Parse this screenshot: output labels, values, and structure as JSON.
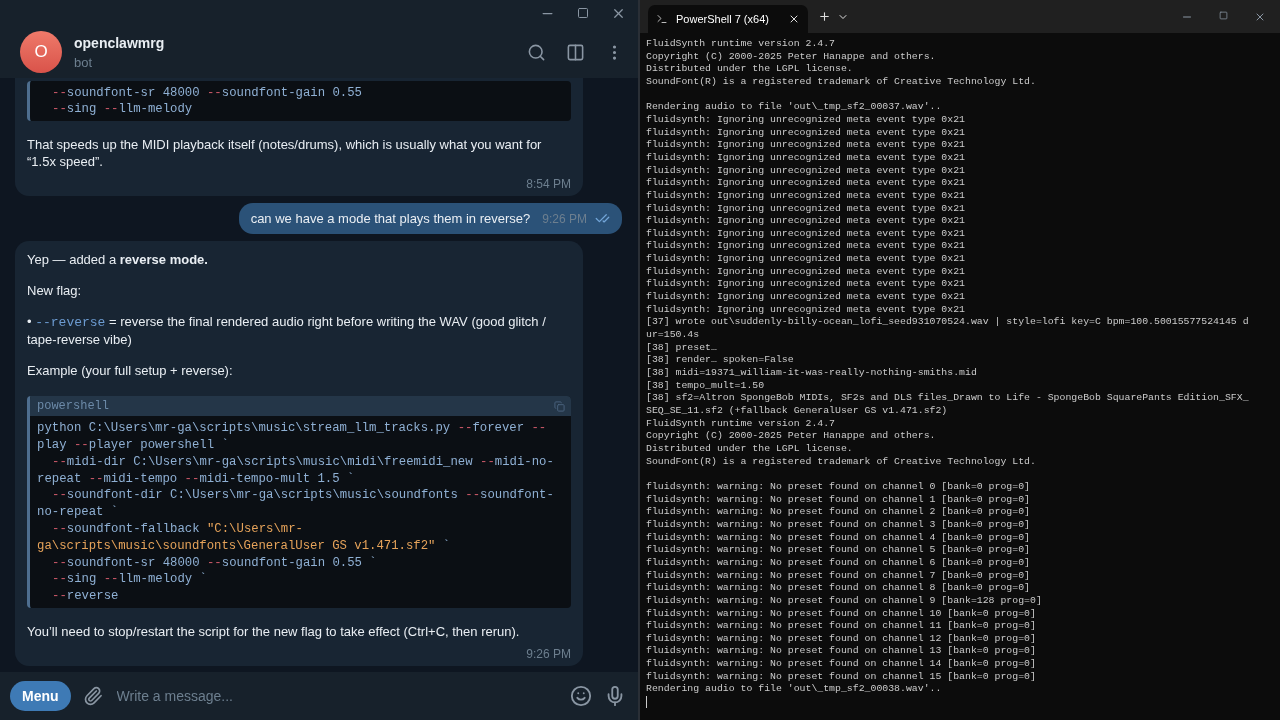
{
  "chat": {
    "header": {
      "avatar_letter": "O",
      "name": "openclawmrg",
      "status": "bot"
    },
    "messages": [
      {
        "kind": "incoming",
        "blocks": [
          {
            "kind": "code",
            "lines": [
              {
                "indent": true,
                "tokens": [
                  {
                    "kind": "op",
                    "t": "--"
                  },
                  {
                    "kind": "plain",
                    "t": "soundfont-sr 48000 "
                  },
                  {
                    "kind": "op",
                    "t": "--"
                  },
                  {
                    "kind": "plain",
                    "t": "soundfont-gain 0.55"
                  }
                ]
              },
              {
                "indent": true,
                "tokens": [
                  {
                    "kind": "op",
                    "t": "--"
                  },
                  {
                    "kind": "plain",
                    "t": "sing "
                  },
                  {
                    "kind": "op",
                    "t": "--"
                  },
                  {
                    "kind": "plain",
                    "t": "llm-melody"
                  }
                ]
              }
            ]
          },
          {
            "kind": "text",
            "segments": [
              {
                "kind": "text",
                "t": "That speeds up the MIDI playback itself (notes/drums), which is usually what you want for “1.5x speed”."
              }
            ]
          }
        ],
        "time": "8:54 PM"
      },
      {
        "kind": "outgoing",
        "blocks": [
          {
            "kind": "text",
            "segments": [
              {
                "kind": "text",
                "t": "can we have a mode that plays them in reverse?"
              }
            ]
          }
        ],
        "time": "9:26 PM",
        "read": true
      },
      {
        "kind": "incoming",
        "blocks": [
          {
            "kind": "text",
            "segments": [
              {
                "kind": "text",
                "t": "Yep — added a **reverse mode.**"
              }
            ]
          },
          {
            "kind": "text",
            "segments": [
              {
                "kind": "text",
                "t": "New flag:"
              }
            ]
          },
          {
            "kind": "text",
            "segments": [
              {
                "kind": "text",
                "t": "• "
              },
              {
                "kind": "code",
                "t": "--reverse"
              },
              {
                "kind": "text",
                "t": " = reverse the final rendered audio right before writing the WAV (good glitch / tape-reverse vibe)"
              }
            ]
          },
          {
            "kind": "text",
            "segments": [
              {
                "kind": "text",
                "t": "Example (your full setup + reverse):"
              }
            ]
          },
          {
            "kind": "code",
            "language": "powershell",
            "lines": [
              {
                "indent": false,
                "tokens": [
                  {
                    "kind": "plain",
                    "t": "python C:\\Users\\mr-ga\\scripts\\music\\stream_llm_tracks.py "
                  },
                  {
                    "kind": "op",
                    "t": "--"
                  },
                  {
                    "kind": "plain",
                    "t": "forever "
                  },
                  {
                    "kind": "op",
                    "t": "--"
                  }
                ]
              },
              {
                "indent": false,
                "tokens": [
                  {
                    "kind": "plain",
                    "t": "play "
                  },
                  {
                    "kind": "op",
                    "t": "--"
                  },
                  {
                    "kind": "plain",
                    "t": "player powershell `"
                  }
                ]
              },
              {
                "indent": true,
                "tokens": [
                  {
                    "kind": "op",
                    "t": "--"
                  },
                  {
                    "kind": "plain",
                    "t": "midi-dir C:\\Users\\mr-ga\\scripts\\music\\midi\\freemidi_new "
                  },
                  {
                    "kind": "op",
                    "t": "--"
                  },
                  {
                    "kind": "plain",
                    "t": "midi-no-"
                  }
                ]
              },
              {
                "indent": false,
                "tokens": [
                  {
                    "kind": "plain",
                    "t": "repeat "
                  },
                  {
                    "kind": "op",
                    "t": "--"
                  },
                  {
                    "kind": "plain",
                    "t": "midi-tempo "
                  },
                  {
                    "kind": "op",
                    "t": "--"
                  },
                  {
                    "kind": "plain",
                    "t": "midi-tempo-mult 1.5 `"
                  }
                ]
              },
              {
                "indent": true,
                "tokens": [
                  {
                    "kind": "op",
                    "t": "--"
                  },
                  {
                    "kind": "plain",
                    "t": "soundfont-dir C:\\Users\\mr-ga\\scripts\\music\\soundfonts "
                  },
                  {
                    "kind": "op",
                    "t": "--"
                  },
                  {
                    "kind": "plain",
                    "t": "soundfont-"
                  }
                ]
              },
              {
                "indent": false,
                "tokens": [
                  {
                    "kind": "plain",
                    "t": "no-repeat `"
                  }
                ]
              },
              {
                "indent": true,
                "tokens": [
                  {
                    "kind": "op",
                    "t": "--"
                  },
                  {
                    "kind": "plain",
                    "t": "soundfont-fallback "
                  },
                  {
                    "kind": "str",
                    "t": "\"C:\\Users\\mr-"
                  }
                ]
              },
              {
                "indent": false,
                "tokens": [
                  {
                    "kind": "str",
                    "t": "ga\\scripts\\music\\soundfonts\\GeneralUser GS v1.471.sf2\""
                  },
                  {
                    "kind": "plain",
                    "t": " `"
                  }
                ]
              },
              {
                "indent": true,
                "tokens": [
                  {
                    "kind": "op",
                    "t": "--"
                  },
                  {
                    "kind": "plain",
                    "t": "soundfont-sr 48000 "
                  },
                  {
                    "kind": "op",
                    "t": "--"
                  },
                  {
                    "kind": "plain",
                    "t": "soundfont-gain 0.55 `"
                  }
                ]
              },
              {
                "indent": true,
                "tokens": [
                  {
                    "kind": "op",
                    "t": "--"
                  },
                  {
                    "kind": "plain",
                    "t": "sing "
                  },
                  {
                    "kind": "op",
                    "t": "--"
                  },
                  {
                    "kind": "plain",
                    "t": "llm-melody `"
                  }
                ]
              },
              {
                "indent": true,
                "tokens": [
                  {
                    "kind": "op",
                    "t": "--"
                  },
                  {
                    "kind": "plain",
                    "t": "reverse"
                  }
                ]
              }
            ]
          },
          {
            "kind": "text",
            "segments": [
              {
                "kind": "text",
                "t": "You’ll need to stop/restart the script for the new flag to take effect (Ctrl+C, then rerun)."
              }
            ]
          }
        ],
        "time": "9:26 PM"
      }
    ],
    "composer": {
      "menu_button": "Menu",
      "placeholder": "Write a message..."
    }
  },
  "terminal": {
    "tab": {
      "title": "PowerShell 7 (x64)",
      "selected": true
    },
    "output": [
      [
        "FluidSynth runtime version 2.4.7",
        "Copyright (C) 2000-2025 Peter Hanappe and others.",
        "Distributed under the LGPL license.",
        "SoundFont(R) is a registered trademark of Creative Technology Ltd."
      ],
      [
        "Rendering audio to file 'out\\_tmp_sf2_00037.wav'..",
        "fluidsynth: Ignoring unrecognized meta event type 0x21",
        "fluidsynth: Ignoring unrecognized meta event type 0x21",
        "fluidsynth: Ignoring unrecognized meta event type 0x21",
        "fluidsynth: Ignoring unrecognized meta event type 0x21",
        "fluidsynth: Ignoring unrecognized meta event type 0x21",
        "fluidsynth: Ignoring unrecognized meta event type 0x21",
        "fluidsynth: Ignoring unrecognized meta event type 0x21",
        "fluidsynth: Ignoring unrecognized meta event type 0x21",
        "fluidsynth: Ignoring unrecognized meta event type 0x21",
        "fluidsynth: Ignoring unrecognized meta event type 0x21",
        "fluidsynth: Ignoring unrecognized meta event type 0x21",
        "fluidsynth: Ignoring unrecognized meta event type 0x21",
        "fluidsynth: Ignoring unrecognized meta event type 0x21",
        "fluidsynth: Ignoring unrecognized meta event type 0x21",
        "fluidsynth: Ignoring unrecognized meta event type 0x21",
        "fluidsynth: Ignoring unrecognized meta event type 0x21",
        "[37] wrote out\\suddenly-billy-ocean_lofi_seed931070524.wav | style=lofi key=C bpm=100.50015577524145 d",
        "ur=150.4s",
        "[38] preset…",
        "[38] render… spoken=False",
        "[38] midi=19371_william-it-was-really-nothing-smiths.mid",
        "[38] tempo_mult=1.50",
        "[38] sf2=Altron SpongeBob MIDIs, SF2s and DLS files_Drawn to Life - SpongeBob SquarePants Edition_SFX_",
        "SEQ_SE_11.sf2 (+fallback GeneralUser GS v1.471.sf2)",
        "FluidSynth runtime version 2.4.7",
        "Copyright (C) 2000-2025 Peter Hanappe and others.",
        "Distributed under the LGPL license.",
        "SoundFont(R) is a registered trademark of Creative Technology Ltd."
      ],
      [
        "fluidsynth: warning: No preset found on channel 0 [bank=0 prog=0]",
        "fluidsynth: warning: No preset found on channel 1 [bank=0 prog=0]",
        "fluidsynth: warning: No preset found on channel 2 [bank=0 prog=0]",
        "fluidsynth: warning: No preset found on channel 3 [bank=0 prog=0]",
        "fluidsynth: warning: No preset found on channel 4 [bank=0 prog=0]",
        "fluidsynth: warning: No preset found on channel 5 [bank=0 prog=0]",
        "fluidsynth: warning: No preset found on channel 6 [bank=0 prog=0]",
        "fluidsynth: warning: No preset found on channel 7 [bank=0 prog=0]",
        "fluidsynth: warning: No preset found on channel 8 [bank=0 prog=0]",
        "fluidsynth: warning: No preset found on channel 9 [bank=128 prog=0]",
        "fluidsynth: warning: No preset found on channel 10 [bank=0 prog=0]",
        "fluidsynth: warning: No preset found on channel 11 [bank=0 prog=0]",
        "fluidsynth: warning: No preset found on channel 12 [bank=0 prog=0]",
        "fluidsynth: warning: No preset found on channel 13 [bank=0 prog=0]",
        "fluidsynth: warning: No preset found on channel 14 [bank=0 prog=0]",
        "fluidsynth: warning: No preset found on channel 15 [bank=0 prog=0]",
        "Rendering audio to file 'out\\_tmp_sf2_00038.wav'.."
      ]
    ],
    "cursor": true
  }
}
